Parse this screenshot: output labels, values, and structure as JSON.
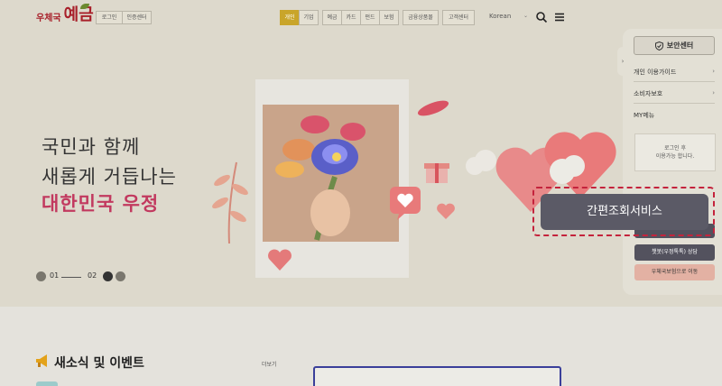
{
  "header": {
    "logo_small": "우체국",
    "logo_big": "예금",
    "login_label": "로그인",
    "cert_label": "인증센터",
    "nav": [
      {
        "label": "개인",
        "active": true
      },
      {
        "label": "기업",
        "active": false
      },
      {
        "label": "예금",
        "active": false
      },
      {
        "label": "카드",
        "active": false
      },
      {
        "label": "펀드",
        "active": false
      },
      {
        "label": "보험",
        "active": false
      },
      {
        "label": "금융상품몰",
        "active": false
      },
      {
        "label": "고객센터",
        "active": false
      }
    ],
    "language": "Korean",
    "icons": [
      "search-icon",
      "menu-icon"
    ]
  },
  "hero": {
    "line1": "국민과 함께",
    "line2": "새롭게 거듭나는",
    "accent": "대한민국 우정",
    "pager_current": "01",
    "pager_next": "02",
    "accent_color": "#c2395f"
  },
  "panel": {
    "security_center": "보안센터",
    "items": [
      {
        "label": "개인 이용가이드"
      },
      {
        "label": "소비자보호"
      },
      {
        "label": "MY메뉴"
      }
    ],
    "login_note_line1": "로그인 후",
    "login_note_line2": "이용가능 합니다.",
    "chatbot_label": "챗봇(우정톡톡) 상담",
    "insurance_link": "우체국보험으로 이동",
    "quick_service": "간편조회서비스"
  },
  "news": {
    "title": "새소식 및 이벤트",
    "more": "더보기"
  },
  "colors": {
    "brand": "#a8202a",
    "active_nav": "#c9a52a",
    "highlight": "#c4233c",
    "quick_button": "#5b5a66"
  }
}
